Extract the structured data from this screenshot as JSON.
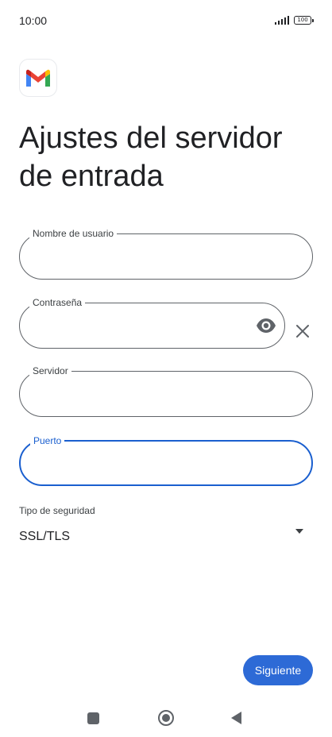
{
  "status_bar": {
    "time": "10:00",
    "battery": "100"
  },
  "app": {
    "logo_icon": "gmail-logo"
  },
  "page": {
    "title": "Ajustes del servidor de entrada"
  },
  "fields": {
    "username": {
      "label": "Nombre de usuario",
      "value": ""
    },
    "password": {
      "label": "Contraseña",
      "value": ""
    },
    "server": {
      "label": "Servidor",
      "value": ""
    },
    "port": {
      "label": "Puerto",
      "value": ""
    }
  },
  "security": {
    "label": "Tipo de seguridad",
    "value": "SSL/TLS"
  },
  "actions": {
    "next_label": "Siguiente"
  },
  "colors": {
    "accent": "#2d6ad6",
    "focus": "#1a5fcf",
    "outline": "#5f6368"
  }
}
